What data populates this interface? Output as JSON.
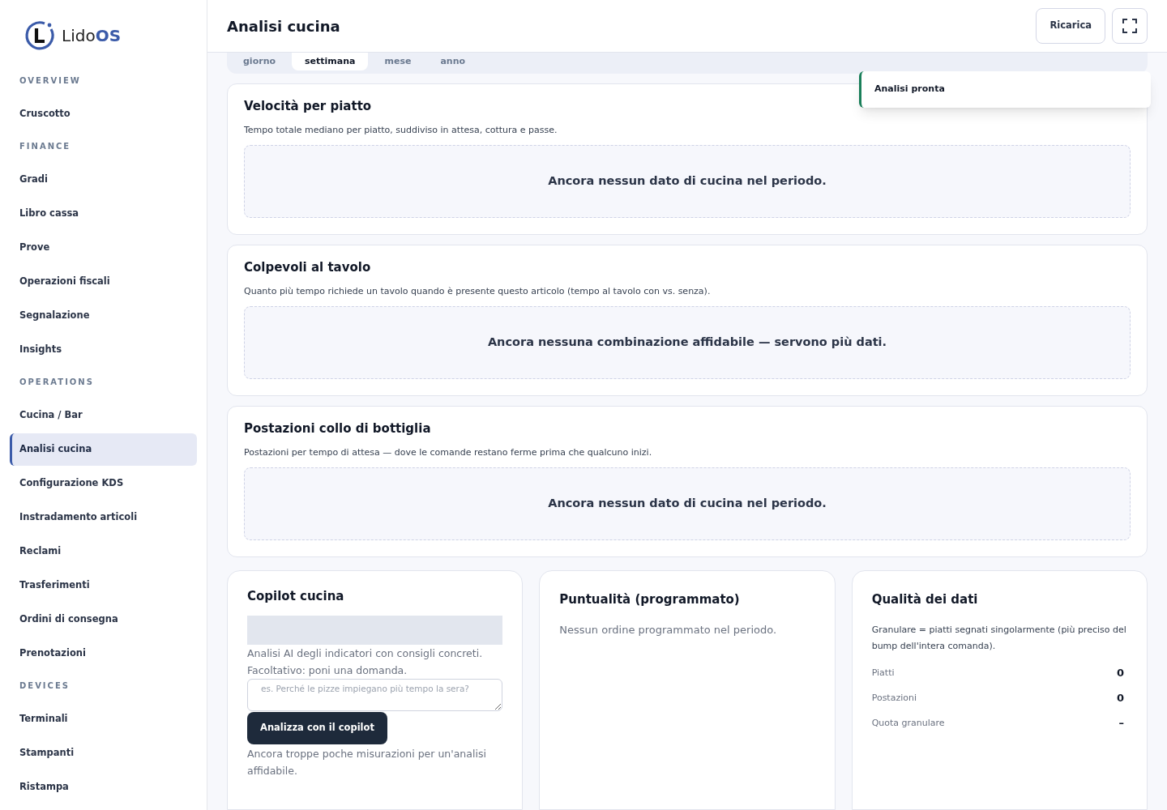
{
  "brand": {
    "name": "Lido",
    "suffix": "OS"
  },
  "sidebar": {
    "sections": [
      {
        "heading": "OVERVIEW",
        "items": [
          {
            "label": "Cruscotto",
            "selected": false
          }
        ]
      },
      {
        "heading": "FINANCE",
        "items": [
          {
            "label": "Gradi",
            "selected": false
          },
          {
            "label": "Libro cassa",
            "selected": false
          },
          {
            "label": "Prove",
            "selected": false
          },
          {
            "label": "Operazioni fiscali",
            "selected": false
          },
          {
            "label": "Segnalazione",
            "selected": false
          },
          {
            "label": "Insights",
            "selected": false
          }
        ]
      },
      {
        "heading": "OPERATIONS",
        "items": [
          {
            "label": "Cucina / Bar",
            "selected": false
          },
          {
            "label": "Analisi cucina",
            "selected": true
          },
          {
            "label": "Configurazione KDS",
            "selected": false
          },
          {
            "label": "Instradamento articoli",
            "selected": false
          },
          {
            "label": "Reclami",
            "selected": false
          },
          {
            "label": "Trasferimenti",
            "selected": false
          },
          {
            "label": "Ordini di consegna",
            "selected": false
          },
          {
            "label": "Prenotazioni",
            "selected": false
          }
        ]
      },
      {
        "heading": "DEVICES",
        "items": [
          {
            "label": "Terminali",
            "selected": false
          },
          {
            "label": "Stampanti",
            "selected": false
          },
          {
            "label": "Ristampa",
            "selected": false
          }
        ]
      }
    ]
  },
  "header": {
    "title": "Analisi cucina",
    "reload_button": "Ricarica"
  },
  "period_tabs": [
    {
      "label": "giorno",
      "selected": false
    },
    {
      "label": "settimana",
      "selected": true
    },
    {
      "label": "mese",
      "selected": false
    },
    {
      "label": "anno",
      "selected": false
    }
  ],
  "toast": {
    "text": "Analisi pronta"
  },
  "cards": [
    {
      "title": "Velocità per piatto",
      "description": "Tempo totale mediano per piatto, suddiviso in attesa, cottura e passe.",
      "empty": "Ancora nessun dato di cucina nel periodo."
    },
    {
      "title": "Colpevoli al tavolo",
      "description": "Quanto più tempo richiede un tavolo quando è presente questo articolo (tempo al tavolo con vs. senza).",
      "empty": "Ancora nessuna combinazione affidabile — servono più dati."
    },
    {
      "title": "Postazioni collo di bottiglia",
      "description": "Postazioni per tempo di attesa — dove le comande restano ferme prima che qualcuno inizi.",
      "empty": "Ancora nessun dato di cucina nel periodo."
    }
  ],
  "copilot": {
    "title": "Copilot cucina",
    "intro": "Analisi AI degli indicatori con consigli concreti.",
    "question_label": "Facoltativo: poni una domanda.",
    "placeholder": "es. Perché le pizze impiegano più tempo la sera?",
    "button": "Analizza con il copilot",
    "note": "Ancora troppe poche misurazioni per un'analisi affidabile."
  },
  "punctuality": {
    "title": "Puntualità (programmato)",
    "text": "Nessun ordine programmato nel periodo."
  },
  "data_quality": {
    "title": "Qualità dei dati",
    "description": "Granulare = piatti segnati singolarmente (più preciso del bump dell'intera comanda).",
    "rows": [
      {
        "label": "Piatti",
        "value": "0"
      },
      {
        "label": "Postazioni",
        "value": "0"
      },
      {
        "label": "Quota granulare",
        "value": "–"
      }
    ]
  }
}
